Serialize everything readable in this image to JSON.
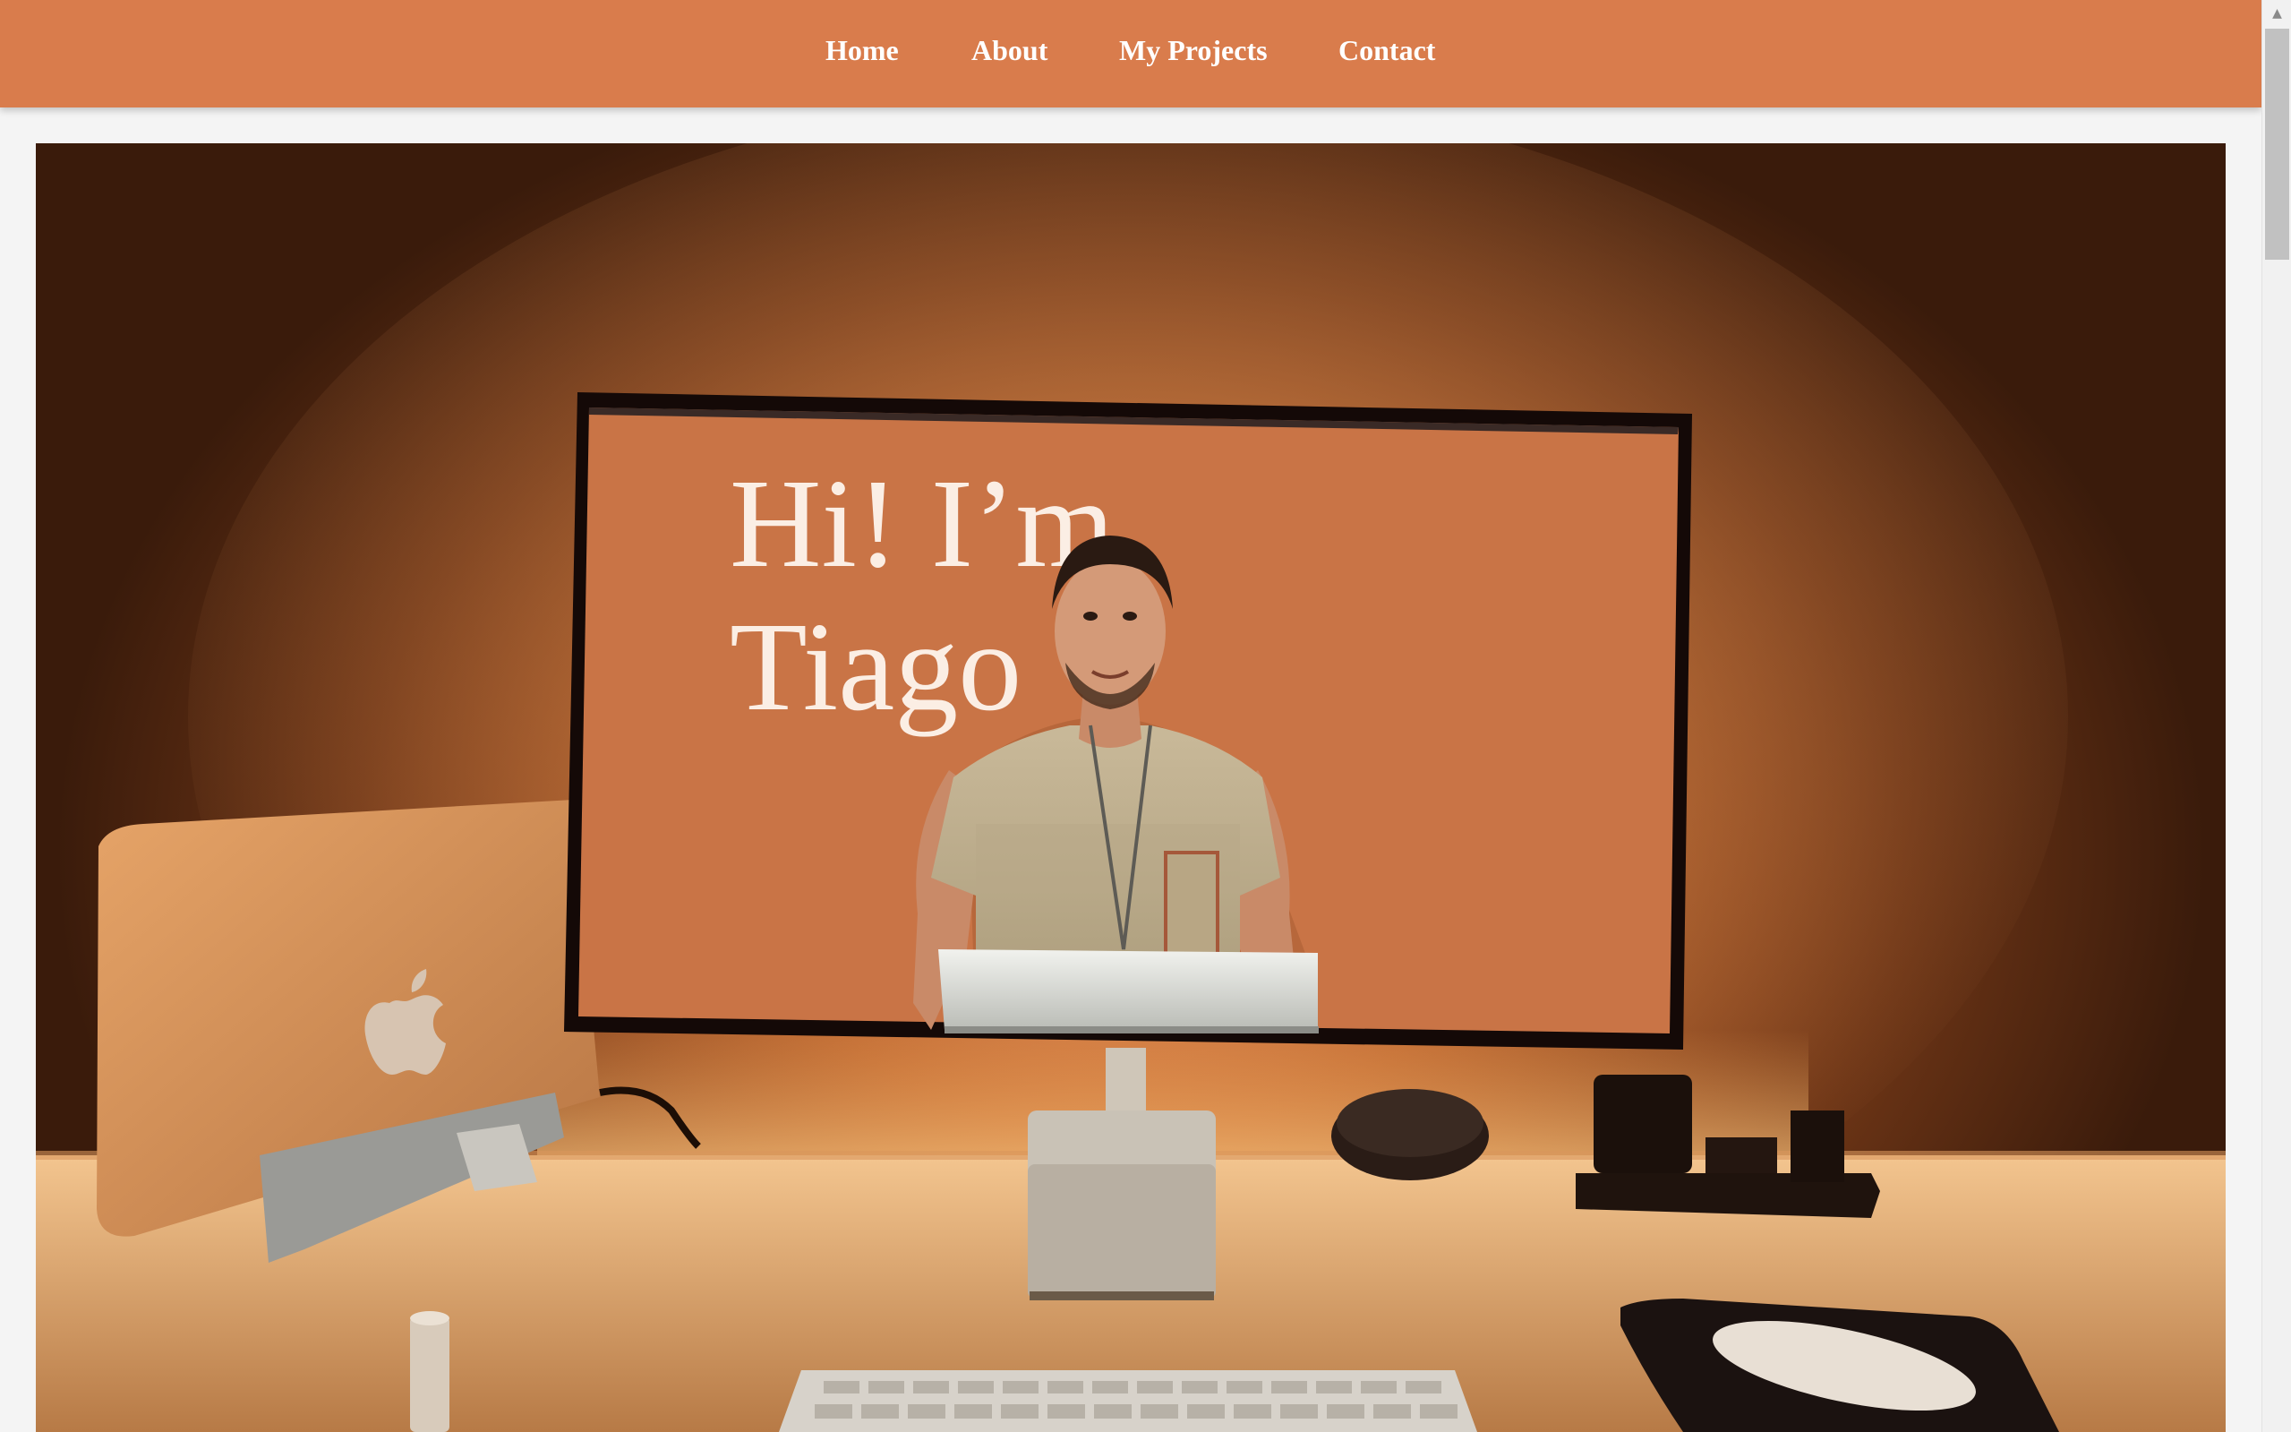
{
  "nav": {
    "items": [
      {
        "label": "Home"
      },
      {
        "label": "About"
      },
      {
        "label": "My Projects"
      },
      {
        "label": "Contact"
      }
    ]
  },
  "hero": {
    "greeting_line1": "Hi! I’m",
    "greeting_line2": "Tiago"
  },
  "colors": {
    "nav_background": "#d97c4c",
    "nav_text": "#ffffff",
    "page_background": "#f4f4f4",
    "screen_orange": "#c97446"
  },
  "icons": {
    "scroll_up": "triangle-up-icon",
    "laptop_logo": "apple-logo-icon"
  }
}
